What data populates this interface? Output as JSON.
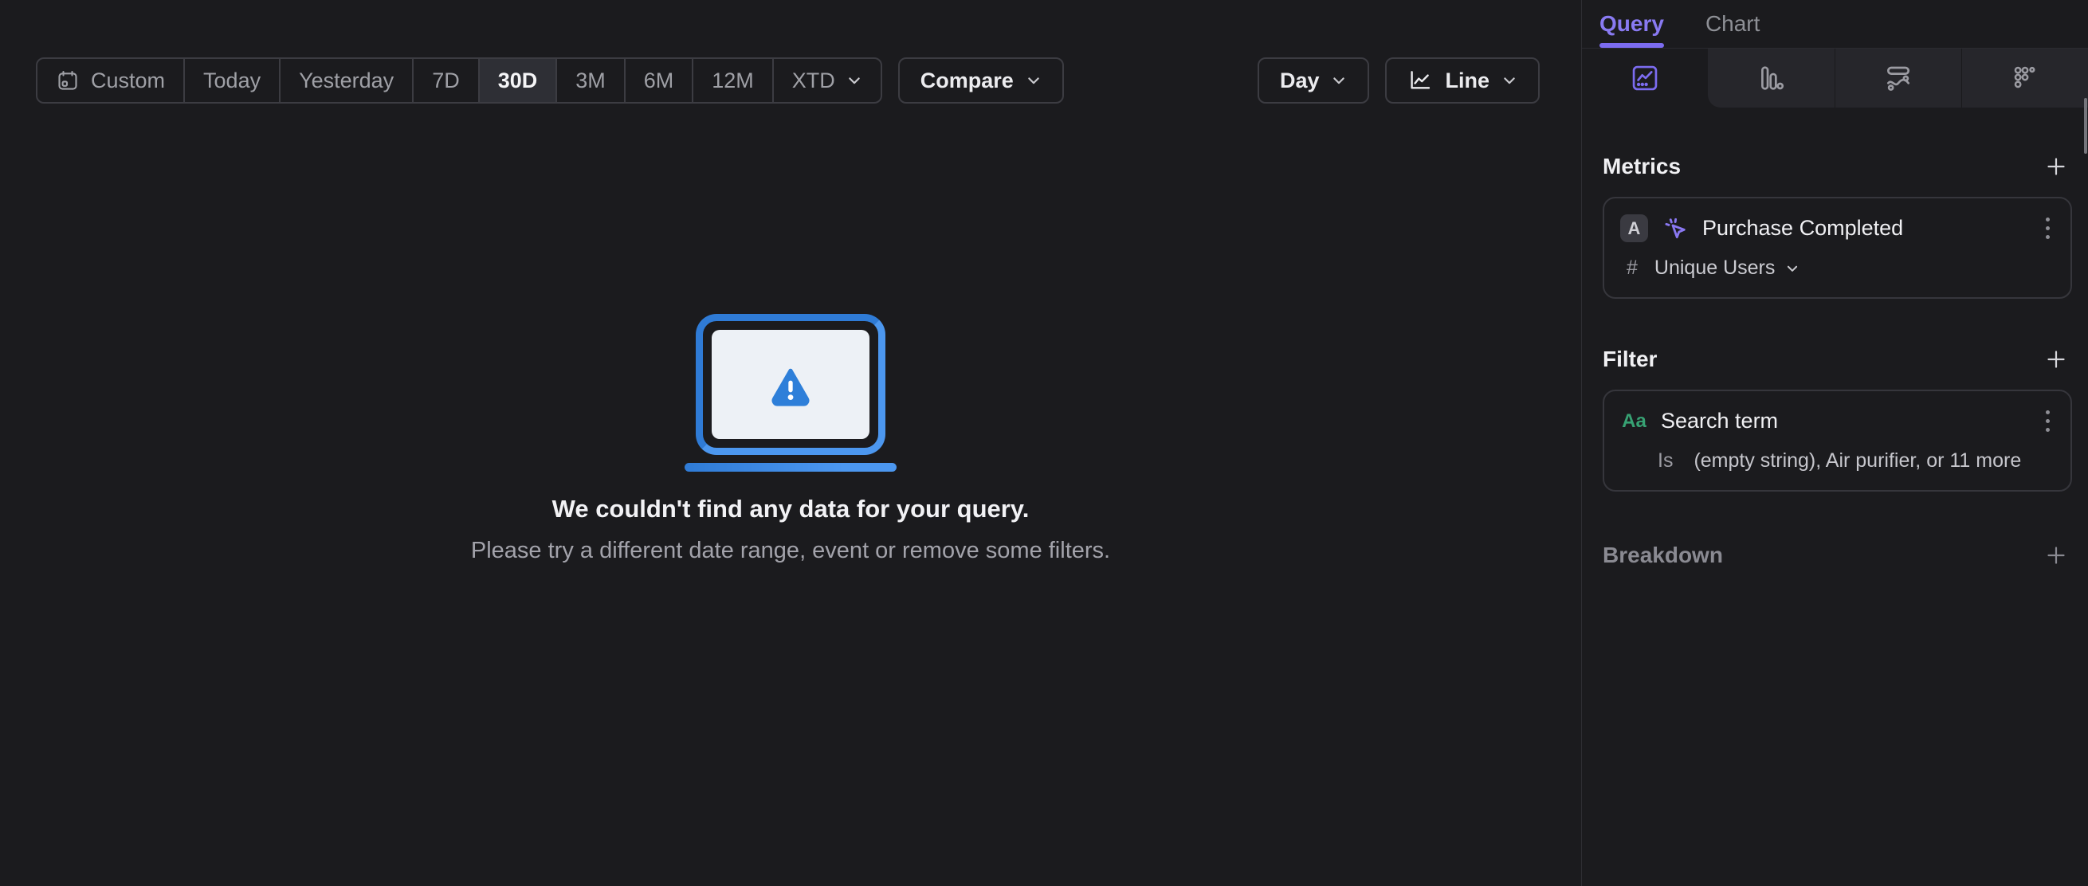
{
  "toolbar": {
    "date_ranges": [
      "Custom",
      "Today",
      "Yesterday",
      "7D",
      "30D",
      "3M",
      "6M",
      "12M",
      "XTD"
    ],
    "selected_range": "30D",
    "compare_label": "Compare",
    "interval_label": "Day",
    "chart_type_label": "Line"
  },
  "empty_state": {
    "title": "We couldn't find any data for your query.",
    "subtitle": "Please try a different date range, event or remove some filters."
  },
  "sidebar": {
    "tabs": [
      {
        "label": "Query",
        "active": true
      },
      {
        "label": "Chart",
        "active": false
      }
    ],
    "icon_tabs": [
      {
        "name": "insights-tab",
        "icon": "line-chart-icon",
        "active": true
      },
      {
        "name": "funnels-tab",
        "icon": "bar-chart-icon",
        "active": false
      },
      {
        "name": "flows-tab",
        "icon": "flow-icon",
        "active": false
      },
      {
        "name": "retention-tab",
        "icon": "dots-grid-icon",
        "active": false
      }
    ],
    "metrics": {
      "heading": "Metrics",
      "items": [
        {
          "letter": "A",
          "event": "Purchase Completed",
          "aggregation_symbol": "#",
          "aggregation": "Unique Users"
        }
      ]
    },
    "filter": {
      "heading": "Filter",
      "items": [
        {
          "type_badge": "Aa",
          "property": "Search term",
          "operator": "Is",
          "values": "(empty string), Air purifier, or 11 more"
        }
      ]
    },
    "breakdown": {
      "heading": "Breakdown"
    }
  },
  "colors": {
    "background": "#1b1b1e",
    "accent_purple": "#7c6cf0",
    "string_type_green": "#37a173",
    "illustration_blue": "#3b86e2",
    "selected_segment_bg": "#2e2f35"
  }
}
